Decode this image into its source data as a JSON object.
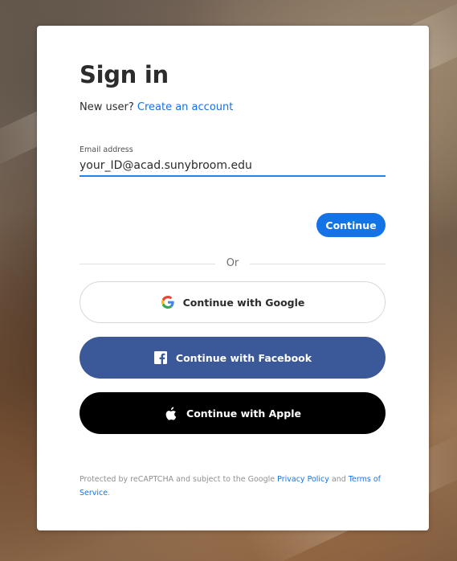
{
  "title": "Sign in",
  "signup": {
    "prompt": "New user?",
    "link_text": "Create an account"
  },
  "email": {
    "label": "Email address",
    "value": "your_ID@acad.sunybroom.edu"
  },
  "continue_label": "Continue",
  "divider_text": "Or",
  "social": {
    "google_label": "Continue with Google",
    "facebook_label": "Continue with Facebook",
    "apple_label": "Continue with Apple"
  },
  "recaptcha": {
    "prefix": "Protected by reCAPTCHA and subject to the Google",
    "privacy_link": "Privacy Policy",
    "conjunction": "and",
    "terms_link": "Terms of Service",
    "suffix": "."
  },
  "colors": {
    "accent": "#1473e6",
    "facebook": "#3b5998",
    "apple": "#000000",
    "google_blue": "#4285f4",
    "google_red": "#ea4335",
    "google_yellow": "#fbbc05",
    "google_green": "#34a853"
  },
  "icons": {
    "google": "google-g-icon",
    "facebook": "facebook-f-icon",
    "apple": "apple-logo-icon"
  }
}
